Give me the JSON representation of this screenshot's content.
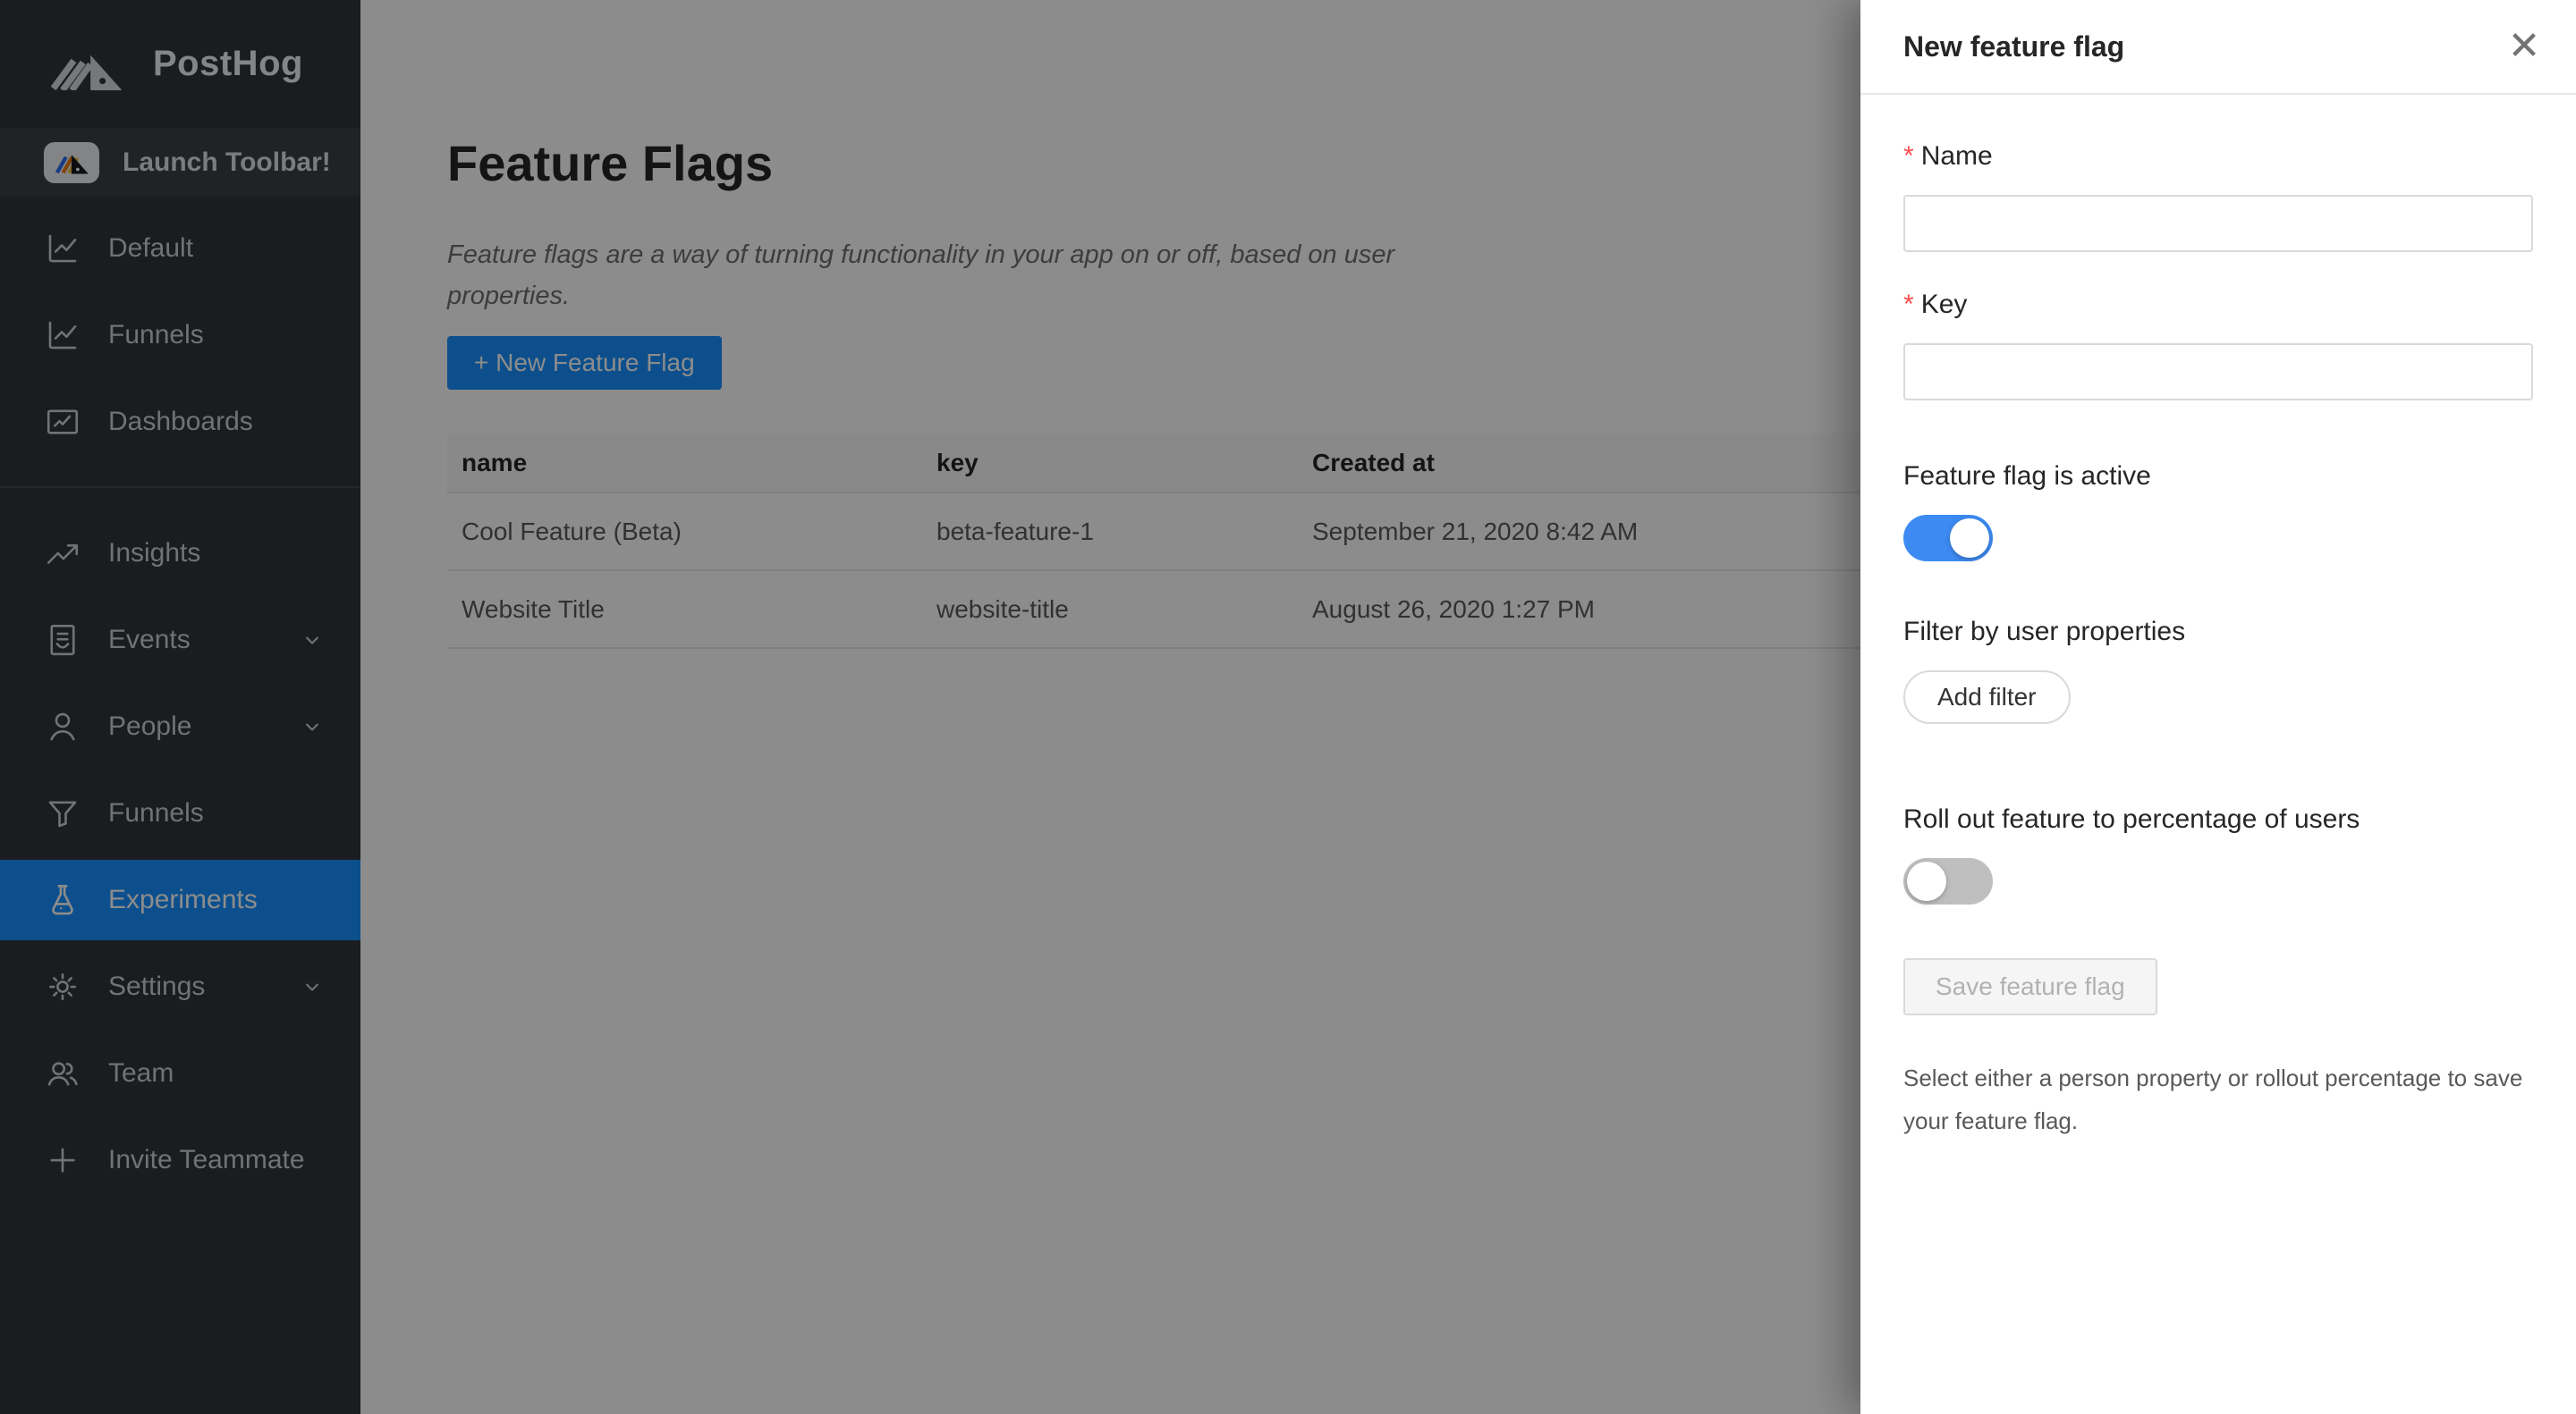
{
  "app": {
    "title": "PostHog"
  },
  "colors": {
    "accent_blue": "#1890ff",
    "switch_on_blue": "#3d8af2",
    "switch_off_gray": "#bfbfbf",
    "required_red": "#ff4d4f",
    "sidebar_bg": "#30333a",
    "mask": "rgba(0,0,0,0.45)"
  },
  "sidebar": {
    "logo_text": "PostHog",
    "launch_toolbar_label": "Launch Toolbar!",
    "items": [
      {
        "label": "Default",
        "icon": "line-chart-icon",
        "selected": false,
        "expandable": false
      },
      {
        "label": "Funnels",
        "icon": "line-chart-icon",
        "selected": false,
        "expandable": false
      },
      {
        "label": "Dashboards",
        "icon": "fund-chart-icon",
        "selected": false,
        "expandable": false
      },
      {
        "label": "Insights",
        "icon": "trend-up-icon",
        "selected": false,
        "expandable": false
      },
      {
        "label": "Events",
        "icon": "events-doc-icon",
        "selected": false,
        "expandable": true
      },
      {
        "label": "People",
        "icon": "person-icon",
        "selected": false,
        "expandable": true
      },
      {
        "label": "Funnels",
        "icon": "funnel-icon",
        "selected": false,
        "expandable": false
      },
      {
        "label": "Experiments",
        "icon": "flask-icon",
        "selected": true,
        "expandable": false
      },
      {
        "label": "Settings",
        "icon": "gear-icon",
        "selected": false,
        "expandable": true
      },
      {
        "label": "Team",
        "icon": "team-icon",
        "selected": false,
        "expandable": false
      },
      {
        "label": "Invite Teammate",
        "icon": "plus-icon",
        "selected": false,
        "expandable": false
      }
    ]
  },
  "main": {
    "title": "Feature Flags",
    "description": "Feature flags are a way of turning functionality in your app on or off, based on user properties.",
    "new_flag_button": "+ New Feature Flag",
    "table": {
      "columns": [
        "name",
        "key",
        "Created at"
      ],
      "rows": [
        {
          "name": "Cool Feature (Beta)",
          "key": "beta-feature-1",
          "created_at": "September 21, 2020 8:42 AM"
        },
        {
          "name": "Website Title",
          "key": "website-title",
          "created_at": "August 26, 2020 1:27 PM"
        }
      ]
    }
  },
  "drawer": {
    "title": "New feature flag",
    "close_icon": "✕",
    "name_field": {
      "label": "Name",
      "required": true,
      "value": ""
    },
    "key_field": {
      "label": "Key",
      "required": true,
      "value": ""
    },
    "active_section": {
      "label": "Feature flag is active",
      "toggle_on": true
    },
    "filter_section": {
      "label": "Filter by user properties",
      "button_label": "Add filter"
    },
    "rollout_section": {
      "label": "Roll out feature to percentage of users",
      "toggle_on": false
    },
    "save_button_label": "Save feature flag",
    "help_text": "Select either a person property or rollout percentage to save your feature flag."
  }
}
